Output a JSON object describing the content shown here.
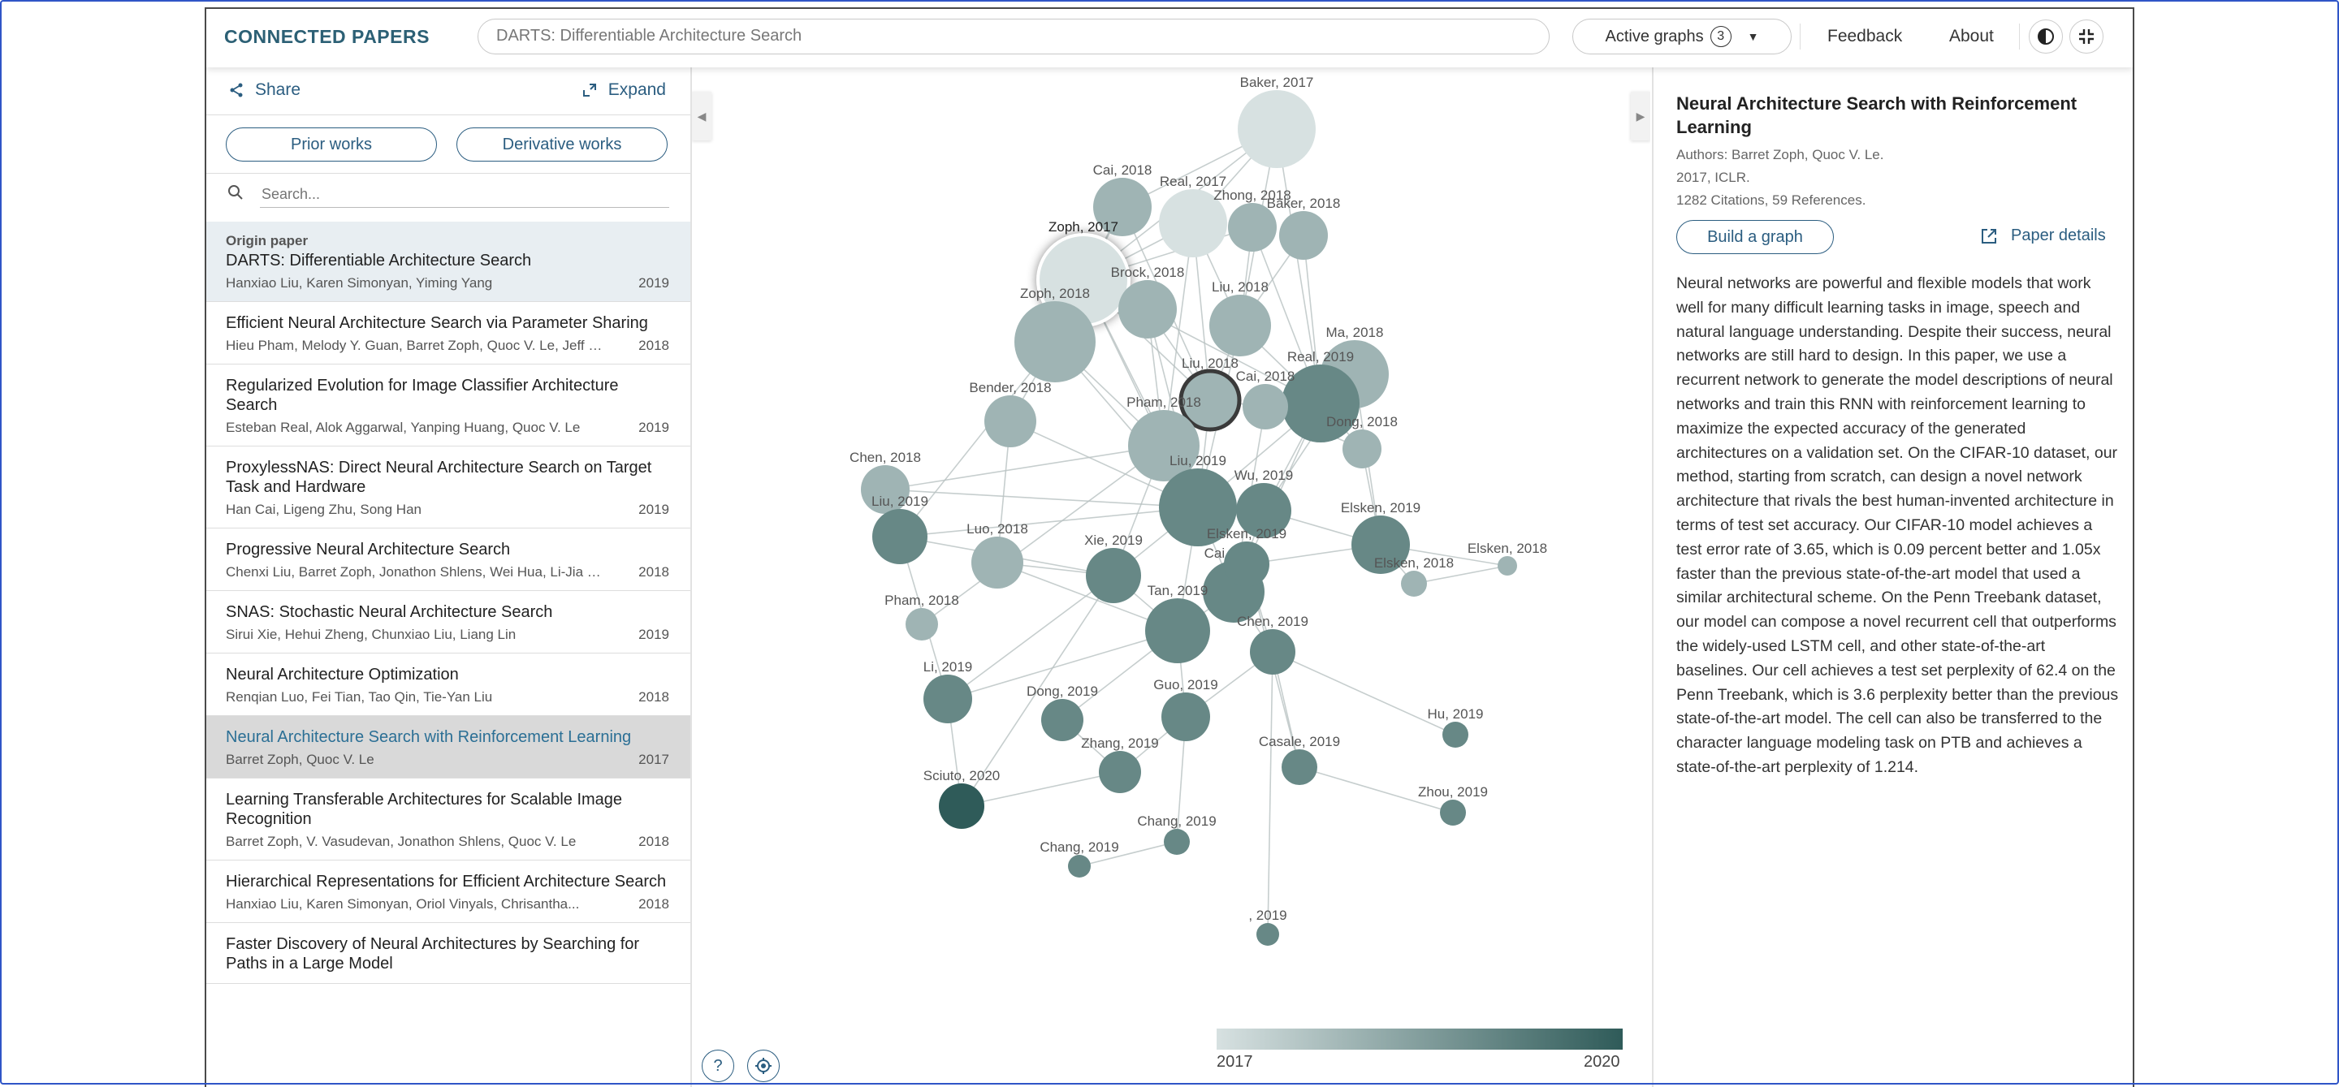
{
  "header": {
    "logo": "CONNECTED PAPERS",
    "search_value": "DARTS: Differentiable Architecture Search",
    "active_graphs_label": "Active graphs",
    "active_graphs_count": "3",
    "feedback": "Feedback",
    "about": "About"
  },
  "left_panel": {
    "share": "Share",
    "expand": "Expand",
    "prior_works": "Prior works",
    "derivative_works": "Derivative works",
    "search_placeholder": "Search...",
    "origin_label": "Origin paper",
    "papers": [
      {
        "title": "DARTS: Differentiable Architecture Search",
        "authors": "Hanxiao Liu, Karen Simonyan, Yiming Yang",
        "year": "2019"
      },
      {
        "title": "Efficient Neural Architecture Search via Parameter Sharing",
        "authors": "Hieu Pham, Melody Y. Guan, Barret Zoph, Quoc V. Le, Jeff Dean",
        "year": "2018"
      },
      {
        "title": "Regularized Evolution for Image Classifier Architecture Search",
        "authors": "Esteban Real, Alok Aggarwal, Yanping Huang, Quoc V. Le",
        "year": "2019"
      },
      {
        "title": "ProxylessNAS: Direct Neural Architecture Search on Target Task and Hardware",
        "authors": "Han Cai, Ligeng Zhu, Song Han",
        "year": "2019"
      },
      {
        "title": "Progressive Neural Architecture Search",
        "authors": "Chenxi Liu, Barret Zoph, Jonathon Shlens, Wei Hua, Li-Jia Li, L...",
        "year": "2018"
      },
      {
        "title": "SNAS: Stochastic Neural Architecture Search",
        "authors": "Sirui Xie, Hehui Zheng, Chunxiao Liu, Liang Lin",
        "year": "2019"
      },
      {
        "title": "Neural Architecture Optimization",
        "authors": "Renqian Luo, Fei Tian, Tao Qin, Tie-Yan Liu",
        "year": "2018"
      },
      {
        "title": "Neural Architecture Search with Reinforcement Learning",
        "authors": "Barret Zoph, Quoc V. Le",
        "year": "2017"
      },
      {
        "title": "Learning Transferable Architectures for Scalable Image Recognition",
        "authors": "Barret Zoph, V. Vasudevan, Jonathon Shlens, Quoc V. Le",
        "year": "2018"
      },
      {
        "title": "Hierarchical Representations for Efficient Architecture Search",
        "authors": "Hanxiao Liu, Karen Simonyan, Oriol Vinyals, Chrisantha...",
        "year": "2018"
      },
      {
        "title": "Faster Discovery of Neural Architectures by Searching for Paths in a Large Model",
        "authors": "",
        "year": ""
      }
    ]
  },
  "graph": {
    "nodes": [
      {
        "label": "Baker, 2017",
        "year": 2017
      },
      {
        "label": "Cai, 2018",
        "year": 2018
      },
      {
        "label": "Real, 2017",
        "year": 2017
      },
      {
        "label": "Zhong, 2018",
        "year": 2018
      },
      {
        "label": "Baker, 2018",
        "year": 2018
      },
      {
        "label": "Zoph, 2017",
        "year": 2017
      },
      {
        "label": "Brock, 2018",
        "year": 2018
      },
      {
        "label": "Liu, 2018",
        "year": 2018
      },
      {
        "label": "Zoph, 2018",
        "year": 2018
      },
      {
        "label": "Ma, 2018",
        "year": 2018
      },
      {
        "label": "Liu, 2018",
        "year": 2018
      },
      {
        "label": "Real, 2019",
        "year": 2019
      },
      {
        "label": "Cai, 2018",
        "year": 2018
      },
      {
        "label": "Bender, 2018",
        "year": 2018
      },
      {
        "label": "Pham, 2018",
        "year": 2018
      },
      {
        "label": "Dong, 2018",
        "year": 2018
      },
      {
        "label": "Chen, 2018",
        "year": 2018
      },
      {
        "label": "Liu, 2019",
        "year": 2019
      },
      {
        "label": "Wu, 2019",
        "year": 2019
      },
      {
        "label": "Liu, 2019",
        "year": 2019
      },
      {
        "label": "Elsken, 2019",
        "year": 2019
      },
      {
        "label": "Luo, 2018",
        "year": 2018
      },
      {
        "label": "Xie, 2019",
        "year": 2019
      },
      {
        "label": "Cai, 2019",
        "year": 2019
      },
      {
        "label": "Elsken, 2019",
        "year": 2019
      },
      {
        "label": "Elsken, 2018",
        "year": 2018
      },
      {
        "label": "Elsken, 2018",
        "year": 2018
      },
      {
        "label": "Pham, 2018",
        "year": 2018
      },
      {
        "label": "Tan, 2019",
        "year": 2019
      },
      {
        "label": "Chen, 2019",
        "year": 2019
      },
      {
        "label": "Li, 2019",
        "year": 2019
      },
      {
        "label": "Dong, 2019",
        "year": 2019
      },
      {
        "label": "Guo, 2019",
        "year": 2019
      },
      {
        "label": "Hu, 2019",
        "year": 2019
      },
      {
        "label": "Zhang, 2019",
        "year": 2019
      },
      {
        "label": "Casale, 2019",
        "year": 2019
      },
      {
        "label": "Sciuto, 2020",
        "year": 2020
      },
      {
        "label": "Zhou, 2019",
        "year": 2019
      },
      {
        "label": "Chang, 2019",
        "year": 2019
      },
      {
        "label": "Chang, 2019",
        "year": 2019
      },
      {
        "label": ", 2019",
        "year": 2019
      }
    ],
    "legend_start": "2017",
    "legend_end": "2020",
    "colors": {
      "oldest": "#d7e1e1",
      "newest": "#2f5b59",
      "accent": "#2b5d80"
    }
  },
  "right_panel": {
    "title": "Neural Architecture Search with Reinforcement Learning",
    "authors": "Authors: Barret Zoph, Quoc V. Le.",
    "venue": "2017, ICLR.",
    "citations": "1282 Citations, 59 References.",
    "build_graph": "Build a graph",
    "paper_details": "Paper details",
    "abstract": "Neural networks are powerful and flexible models that work well for many difficult learning tasks in image, speech and natural language understanding. Despite their success, neural networks are still hard to design. In this paper, we use a recurrent network to generate the model descriptions of neural networks and train this RNN with reinforcement learning to maximize the expected accuracy of the generated architectures on a validation set. On the CIFAR-10 dataset, our method, starting from scratch, can design a novel network architecture that rivals the best human-invented architecture in terms of test set accuracy. Our CIFAR-10 model achieves a test error rate of 3.65, which is 0.09 percent better and 1.05x faster than the previous state-of-the-art model that used a similar architectural scheme. On the Penn Treebank dataset, our model can compose a novel recurrent cell that outperforms the widely-used LSTM cell, and other state-of-the-art baselines. Our cell achieves a test set perplexity of 62.4 on the Penn Treebank, which is 3.6 perplexity better than the previous state-of-the-art model. The cell can also be transferred to the character language modeling task on PTB and achieves a state-of-the-art perplexity of 1.214."
  }
}
